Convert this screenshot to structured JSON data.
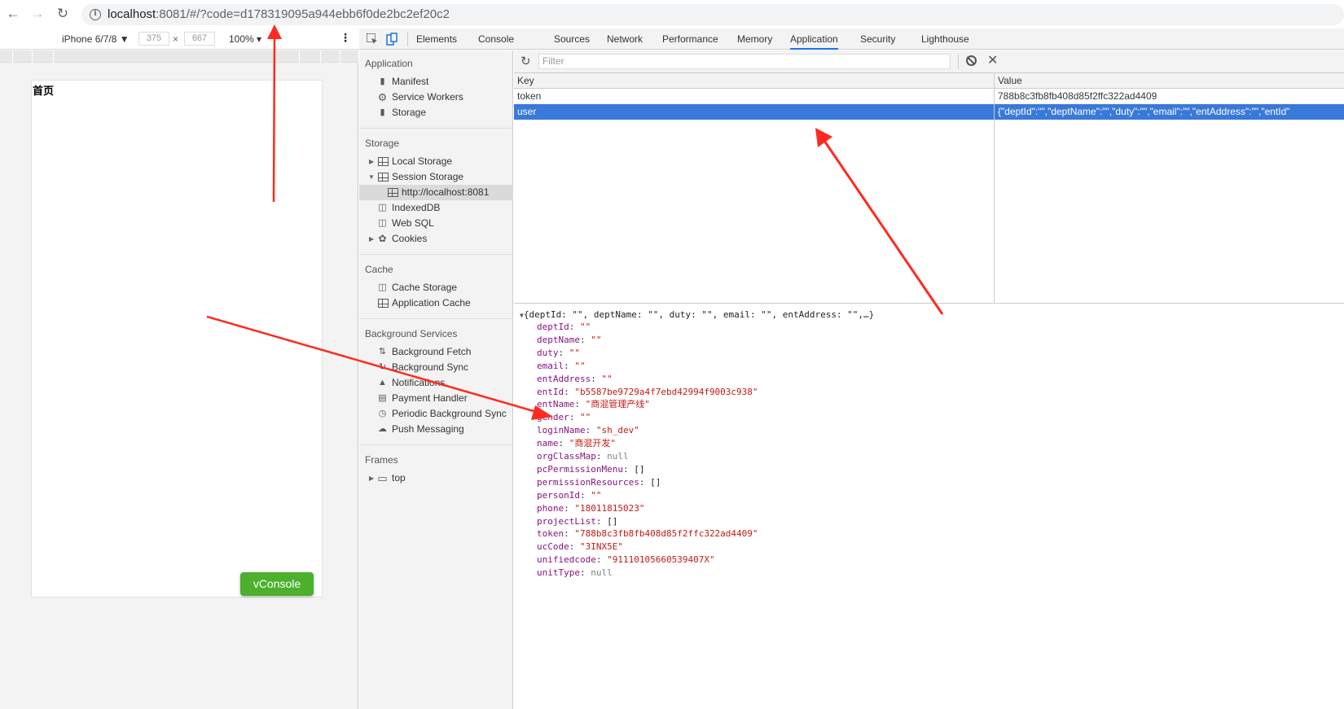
{
  "browser": {
    "url_host": "localhost",
    "url_rest": ":8081/#/?code=d178319095a944ebb6f0de2bc2ef20c2"
  },
  "device_toolbar": {
    "device": "iPhone 6/7/8 ▼",
    "width": "375",
    "height": "667",
    "times": "×",
    "zoom": "100% ▾"
  },
  "phone": {
    "title": "首页",
    "vconsole_label": "vConsole"
  },
  "devtools_tabs": [
    "Elements",
    "Console",
    "Sources",
    "Network",
    "Performance",
    "Memory",
    "Application",
    "Security",
    "Lighthouse"
  ],
  "sidebar": {
    "application_title": "Application",
    "application_items": [
      "Manifest",
      "Service Workers",
      "Storage"
    ],
    "storage_title": "Storage",
    "storage_items": [
      "Local Storage",
      "Session Storage",
      "http://localhost:8081",
      "IndexedDB",
      "Web SQL",
      "Cookies"
    ],
    "cache_title": "Cache",
    "cache_items": [
      "Cache Storage",
      "Application Cache"
    ],
    "bg_title": "Background Services",
    "bg_items": [
      "Background Fetch",
      "Background Sync",
      "Notifications",
      "Payment Handler",
      "Periodic Background Sync",
      "Push Messaging"
    ],
    "frames_title": "Frames",
    "frames_items": [
      "top"
    ]
  },
  "table": {
    "filter_placeholder": "Filter",
    "col_key": "Key",
    "col_value": "Value",
    "rows": [
      {
        "key": "token",
        "value": "788b8c3fb8fb408d85f2ffc322ad4409"
      },
      {
        "key": "user",
        "value": "{\"deptId\":\"\",\"deptName\":\"\",\"duty\":\"\",\"email\":\"\",\"entAddress\":\"\",\"entId\""
      }
    ]
  },
  "preview": {
    "summary": "{deptId: \"\", deptName: \"\", duty: \"\", email: \"\", entAddress: \"\",…}",
    "fields": [
      {
        "k": "deptId",
        "v": "\"\"",
        "t": "str"
      },
      {
        "k": "deptName",
        "v": "\"\"",
        "t": "str"
      },
      {
        "k": "duty",
        "v": "\"\"",
        "t": "str"
      },
      {
        "k": "email",
        "v": "\"\"",
        "t": "str"
      },
      {
        "k": "entAddress",
        "v": "\"\"",
        "t": "str"
      },
      {
        "k": "entId",
        "v": "\"b5587be9729a4f7ebd42994f9003c938\"",
        "t": "str"
      },
      {
        "k": "entName",
        "v": "\"商混管理产线\"",
        "t": "str"
      },
      {
        "k": "gender",
        "v": "\"\"",
        "t": "str"
      },
      {
        "k": "loginName",
        "v": "\"sh_dev\"",
        "t": "str"
      },
      {
        "k": "name",
        "v": "\"商混开发\"",
        "t": "str"
      },
      {
        "k": "orgClassMap",
        "v": "null",
        "t": "null"
      },
      {
        "k": "pcPermissionMenu",
        "v": "[]",
        "t": "arr"
      },
      {
        "k": "permissionResources",
        "v": "[]",
        "t": "arr"
      },
      {
        "k": "personId",
        "v": "\"\"",
        "t": "str"
      },
      {
        "k": "phone",
        "v": "\"18011815023\"",
        "t": "str"
      },
      {
        "k": "projectList",
        "v": "[]",
        "t": "arr"
      },
      {
        "k": "token",
        "v": "\"788b8c3fb8fb408d85f2ffc322ad4409\"",
        "t": "str"
      },
      {
        "k": "ucCode",
        "v": "\"3INX5E\"",
        "t": "str"
      },
      {
        "k": "unifiedcode",
        "v": "\"91110105660539407X\"",
        "t": "str"
      },
      {
        "k": "unitType",
        "v": "null",
        "t": "null"
      }
    ]
  },
  "colors": {
    "accent": "#1a73e8",
    "selected_row": "#3879d9",
    "vconsole_green": "#4cb02d",
    "annotation_arrow": "#ff2a1f"
  }
}
